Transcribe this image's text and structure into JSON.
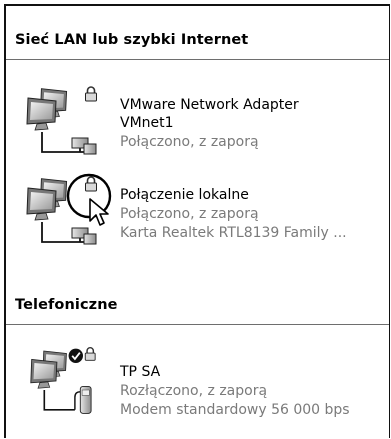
{
  "sections": {
    "lan": {
      "title": "Sieć LAN lub szybki Internet",
      "items": [
        {
          "name_line1": "VMware Network Adapter",
          "name_line2": "VMnet1",
          "status": "Połączono, z zaporą"
        },
        {
          "name": "Połączenie lokalne",
          "status": "Połączono, z zaporą",
          "device": "Karta Realtek RTL8139 Family ..."
        }
      ]
    },
    "dialup": {
      "title": "Telefoniczne",
      "items": [
        {
          "name": "TP SA",
          "status": "Rozłączono, z zaporą",
          "device": "Modem standardowy 56 000 bps"
        }
      ]
    }
  },
  "icons": {
    "network": "network-connection-icon",
    "dialup": "dialup-connection-icon",
    "lock": "firewall-lock-icon",
    "check": "default-connection-check-icon",
    "cursor": "mouse-pointer-icon",
    "highlight": "highlight-circle"
  },
  "colors": {
    "secondary_text": "#7a7a7a",
    "rule": "#6e6e6e"
  }
}
